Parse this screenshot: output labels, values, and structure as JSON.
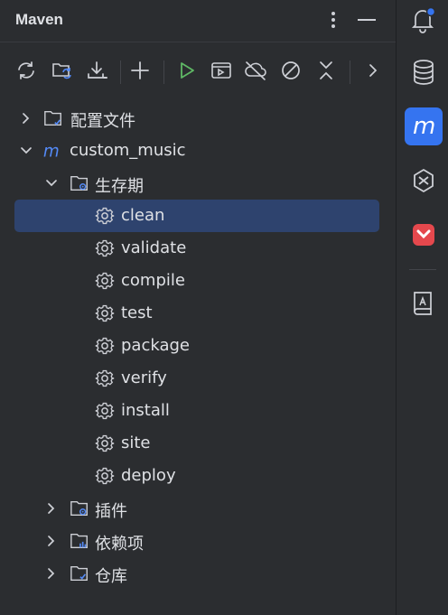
{
  "header": {
    "title": "Maven"
  },
  "tree": {
    "items": [
      {
        "label": "配置文件"
      },
      {
        "label": "custom_music"
      },
      {
        "label": "生存期"
      },
      {
        "label": "clean"
      },
      {
        "label": "validate"
      },
      {
        "label": "compile"
      },
      {
        "label": "test"
      },
      {
        "label": "package"
      },
      {
        "label": "verify"
      },
      {
        "label": "install"
      },
      {
        "label": "site"
      },
      {
        "label": "deploy"
      },
      {
        "label": "插件"
      },
      {
        "label": "依赖项"
      },
      {
        "label": "仓库"
      }
    ]
  },
  "colors": {
    "accent": "#3574f0",
    "selection": "#2e436e",
    "run_green": "#5fb865",
    "maven_blue": "#548af7",
    "notification_dot": "#3574f0"
  }
}
